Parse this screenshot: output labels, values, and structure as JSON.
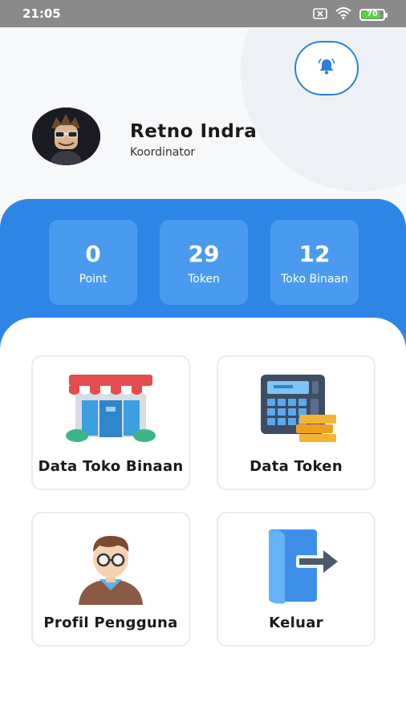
{
  "status_bar": {
    "time": "21:05",
    "battery": "70"
  },
  "profile": {
    "name": "Retno Indra",
    "role": "Koordinator"
  },
  "stats": [
    {
      "value": "0",
      "label": "Point"
    },
    {
      "value": "29",
      "label": "Token"
    },
    {
      "value": "12",
      "label": "Toko Binaan"
    }
  ],
  "menu": [
    {
      "label": "Data Toko Binaan",
      "icon": "store-icon"
    },
    {
      "label": "Data Token",
      "icon": "calculator-icon"
    },
    {
      "label": "Profil Pengguna",
      "icon": "user-profile-icon"
    },
    {
      "label": "Keluar",
      "icon": "logout-door-icon"
    }
  ],
  "colors": {
    "primary": "#2d86e6",
    "card": "#4a9bf0",
    "bell": "#2b7fe0"
  }
}
